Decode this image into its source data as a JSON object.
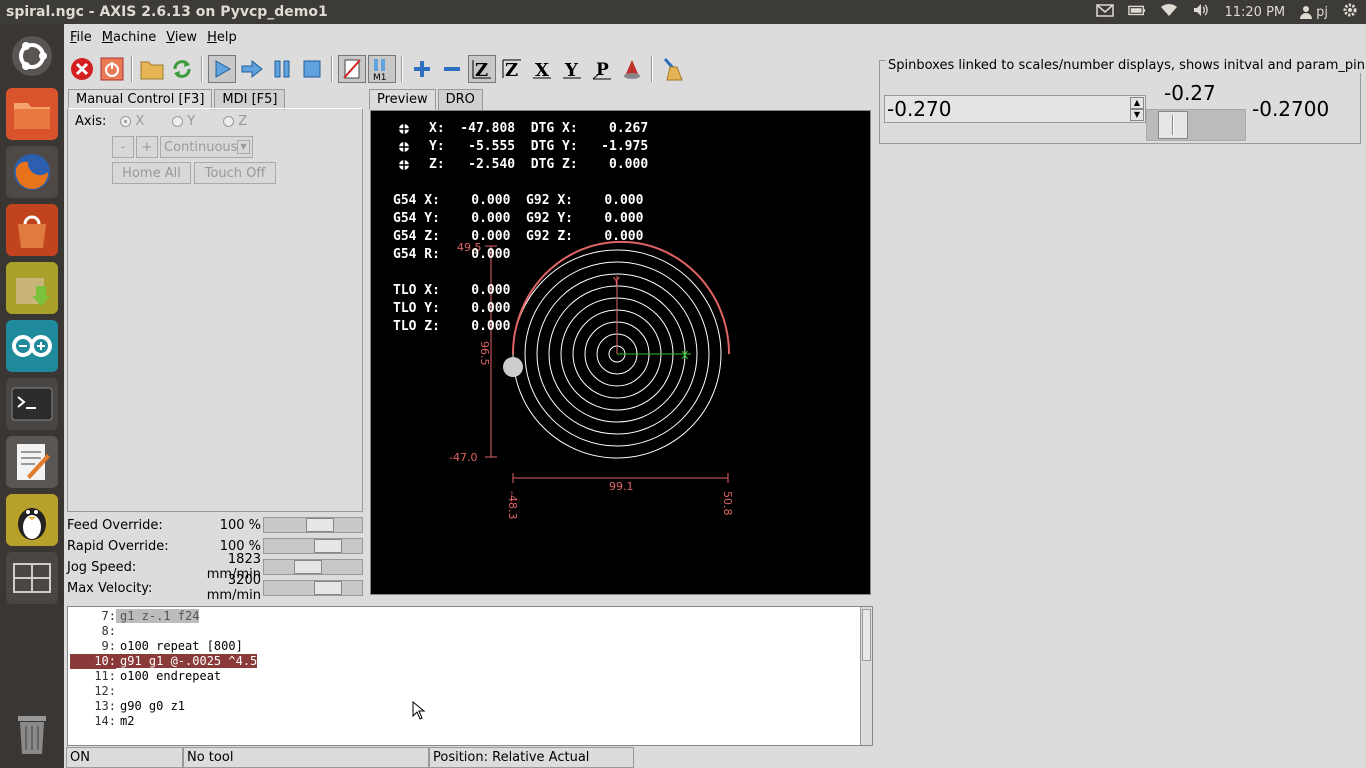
{
  "window": {
    "title": "spiral.ngc - AXIS 2.6.13 on Pyvcp_demo1"
  },
  "topbar": {
    "time": "11:20 PM",
    "user": "pj",
    "icons": [
      "mail-icon",
      "battery-icon",
      "wifi-icon",
      "volume-icon",
      "user-icon",
      "gear-icon"
    ]
  },
  "launcher": {
    "items": [
      "ubuntu-dash-icon",
      "files-icon",
      "firefox-icon",
      "software-center-icon",
      "archive-install-icon",
      "arduino-icon",
      "terminal-icon",
      "text-editor-icon",
      "linuxcnc-icon",
      "workspace-switcher-icon",
      "trash-icon"
    ]
  },
  "menu": {
    "file": "File",
    "machine": "Machine",
    "view": "View",
    "help": "Help"
  },
  "tabs_left": {
    "manual": "Manual Control [F3]",
    "mdi": "MDI [F5]"
  },
  "tabs_right": {
    "preview": "Preview",
    "dro": "DRO"
  },
  "manual": {
    "axis_label": "Axis:",
    "axes": [
      "X",
      "Y",
      "Z"
    ],
    "minus": "-",
    "plus": "+",
    "jog_mode": "Continuous",
    "home_all": "Home All",
    "touch_off": "Touch Off"
  },
  "overrides": [
    {
      "label": "Feed Override:",
      "value": "100 %",
      "level": 0.6
    },
    {
      "label": "Rapid Override:",
      "value": "100 %",
      "level": 0.72
    },
    {
      "label": "Jog Speed:",
      "value": "1823 mm/min",
      "level": 0.43
    },
    {
      "label": "Max Velocity:",
      "value": "3200 mm/min",
      "level": 0.72
    }
  ],
  "dro": {
    "lines": [
      "X:  -47.808  DTG X:    0.267",
      "Y:   -5.555  DTG Y:   -1.975",
      "Z:   -2.540  DTG Z:    0.000",
      "G54 X:    0.000  G92 X:    0.000",
      "G54 Y:    0.000  G92 Y:    0.000",
      "G54 Z:    0.000  G92 Z:    0.000",
      "G54 R:    0.000",
      "TLO X:    0.000",
      "TLO Y:    0.000",
      "TLO Z:    0.000"
    ]
  },
  "extents": {
    "y_max": "49.5",
    "y_min": "-47.0",
    "y_size": "96.5",
    "x_size": "99.1",
    "x_min": "-48.3",
    "x_max": "50.8",
    "axis_x": "X",
    "axis_y": "Y"
  },
  "gcode": [
    {
      "n": "7:",
      "t": "g1 z-.1 f24"
    },
    {
      "n": "8:",
      "t": ""
    },
    {
      "n": "9:",
      "t": "o100 repeat [800]"
    },
    {
      "n": "10:",
      "t": "g91 g1 @-.0025 ^4.5"
    },
    {
      "n": "11:",
      "t": "o100 endrepeat"
    },
    {
      "n": "12:",
      "t": ""
    },
    {
      "n": "13:",
      "t": "g90 g0 z1"
    },
    {
      "n": "14:",
      "t": "m2"
    }
  ],
  "status": {
    "machine": "ON",
    "tool": "No tool",
    "position": "Position: Relative Actual"
  },
  "pyvcp": {
    "legend": "Spinboxes linked to scales/number displays, shows initval and param_pin usage",
    "spinbox": "-0.270",
    "scale_value": "-0.27",
    "scale_level": 0.36,
    "number_display": "-0.2700"
  },
  "colors": {
    "extents": "#e06464",
    "spiral": "#ffffff",
    "axis_x": "#2ec52e",
    "axis_y": "#e06464",
    "active_line": "#8b3a3a"
  }
}
